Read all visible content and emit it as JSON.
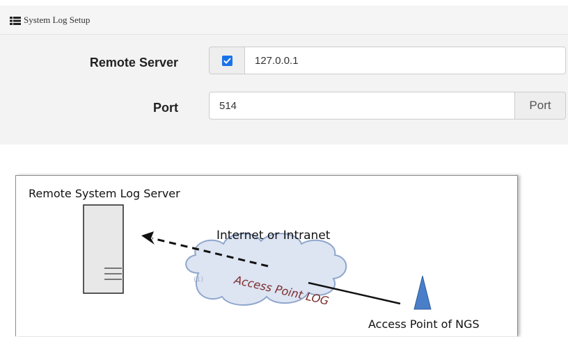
{
  "panel": {
    "title": "System Log Setup",
    "icon": "list-icon"
  },
  "form": {
    "remote_server": {
      "label": "Remote Server",
      "enabled": true,
      "value": "127.0.0.1"
    },
    "port": {
      "label": "Port",
      "value": "514",
      "addon": "Port"
    }
  },
  "diagram": {
    "server_label": "Remote System Log Server",
    "network_label": "Internet or Intranet",
    "log_label": "Access Point LOG",
    "ap_label": "Access Point of NGS",
    "colors": {
      "log_text": "#7b2c2c",
      "access_point": "#4a7ec9",
      "cloud": "#dde4f2"
    }
  }
}
